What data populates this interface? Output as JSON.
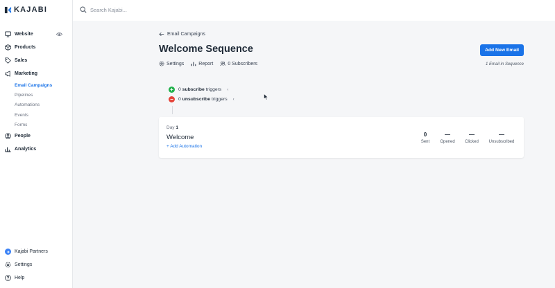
{
  "brand": {
    "name": "KAJABI",
    "color": "#1a73e8"
  },
  "search": {
    "placeholder": "Search Kajabi..."
  },
  "sidebar": {
    "items": [
      {
        "label": "Website",
        "icon": "monitor-icon"
      },
      {
        "label": "Products",
        "icon": "box-icon"
      },
      {
        "label": "Sales",
        "icon": "tag-icon"
      },
      {
        "label": "Marketing",
        "icon": "megaphone-icon"
      },
      {
        "label": "People",
        "icon": "person-icon"
      },
      {
        "label": "Analytics",
        "icon": "bar-chart-icon"
      }
    ],
    "marketing_sub": [
      {
        "label": "Email Campaigns",
        "active": true
      },
      {
        "label": "Pipelines"
      },
      {
        "label": "Automations"
      },
      {
        "label": "Events"
      },
      {
        "label": "Forms"
      }
    ],
    "bottom": [
      {
        "label": "Kajabi Partners",
        "icon": "partner-icon"
      },
      {
        "label": "Settings",
        "icon": "gear-icon"
      },
      {
        "label": "Help",
        "icon": "help-icon"
      }
    ]
  },
  "page": {
    "back_label": "Email Campaigns",
    "title": "Welcome Sequence",
    "add_button": "Add New Email",
    "subnav": {
      "settings": "Settings",
      "report": "Report",
      "subscribers": "0 Subscribers"
    },
    "sequence_count": "1 Email in Sequence"
  },
  "triggers": {
    "subscribe": {
      "count": "0",
      "bold": "subscribe",
      "suffix": "triggers"
    },
    "unsubscribe": {
      "count": "0",
      "bold": "unsubscribe",
      "suffix": "triggers"
    }
  },
  "email": {
    "day_label": "Day",
    "day_num": "1",
    "name": "Welcome",
    "add_automation": "+ Add Automation",
    "stats": [
      {
        "value": "0",
        "label": "Sent"
      },
      {
        "value": "—",
        "label": "Opened"
      },
      {
        "value": "—",
        "label": "Clicked"
      },
      {
        "value": "—",
        "label": "Unsubscribed"
      }
    ]
  }
}
